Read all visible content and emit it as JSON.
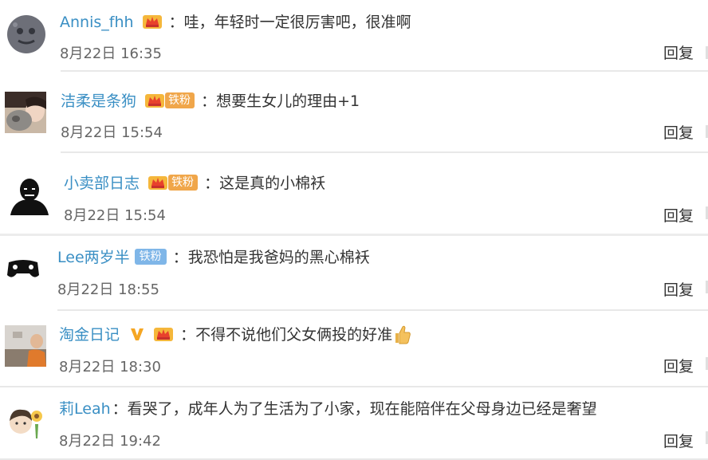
{
  "comments": [
    {
      "user": "Annis_fhh",
      "text": "哇，年轻时一定很厉害吧，很准啊",
      "time": "8月22日 16:35",
      "reply": "回复",
      "badges": [
        "crown"
      ]
    },
    {
      "user": "洁柔是条狗",
      "text": "想要生女儿的理由+1",
      "time": "8月22日 15:54",
      "reply": "回复",
      "badges": [
        "crown-fan"
      ],
      "fan_label": "铁粉"
    },
    {
      "user": "小卖部日志",
      "text": "这是真的小棉袄",
      "time": "8月22日 15:54",
      "reply": "回复",
      "badges": [
        "crown-fan"
      ],
      "fan_label": "铁粉"
    },
    {
      "user": "Lee两岁半",
      "text": "我恐怕是我爸妈的黑心棉袄",
      "time": "8月22日 18:55",
      "reply": "回复",
      "badges": [
        "fan-blue"
      ],
      "fan_label": "铁粉"
    },
    {
      "user": "淘金日记",
      "text": "不得不说他们父女俩投的好准",
      "time": "8月22日 18:30",
      "reply": "回复",
      "badges": [
        "v",
        "crown"
      ],
      "emoji": "thumbs-up"
    },
    {
      "user": "莉Leah",
      "text": "看哭了，成年人为了生活为了小家，现在能陪伴在父母身边已经是奢望",
      "time": "8月22日 19:42",
      "reply": "回复",
      "badges": []
    }
  ],
  "colors": {
    "username": "#3a8fc4",
    "text": "#333333",
    "time": "#666666",
    "fan_badge_orange": "#f0a64a",
    "fan_badge_blue": "#7fb6e8",
    "v_badge": "#f5a623"
  }
}
